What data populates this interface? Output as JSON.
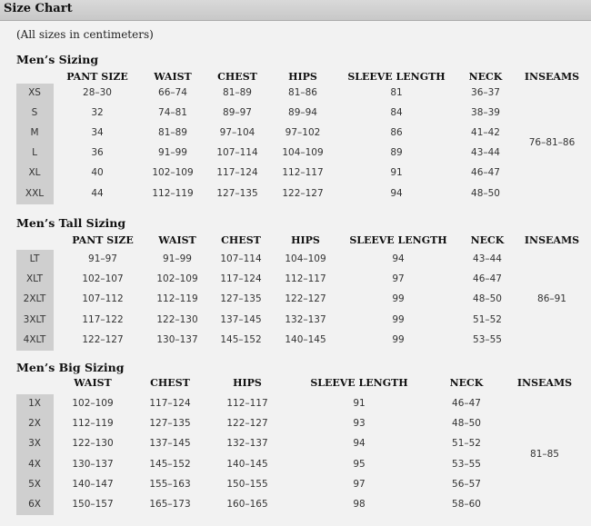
{
  "header": {
    "title": "Size Chart"
  },
  "note": "(All sizes in centimeters)",
  "sections": [
    {
      "title": "Men’s Sizing",
      "headers": [
        "PANT SIZE",
        "WAIST",
        "CHEST",
        "HIPS",
        "SLEEVE LENGTH",
        "NECK",
        "INSEAMS"
      ],
      "rows": [
        {
          "size": "XS",
          "values": [
            "28–30",
            "66–74",
            "81–89",
            "81–86",
            "81",
            "36–37"
          ]
        },
        {
          "size": "S",
          "values": [
            "32",
            "74–81",
            "89–97",
            "89–94",
            "84",
            "38–39"
          ]
        },
        {
          "size": "M",
          "values": [
            "34",
            "81–89",
            "97–104",
            "97–102",
            "86",
            "41–42"
          ]
        },
        {
          "size": "L",
          "values": [
            "36",
            "91–99",
            "107–114",
            "104–109",
            "89",
            "43–44"
          ]
        },
        {
          "size": "XL",
          "values": [
            "40",
            "102–109",
            "117–124",
            "112–117",
            "91",
            "46–47"
          ]
        },
        {
          "size": "XXL",
          "values": [
            "44",
            "112–119",
            "127–135",
            "122–127",
            "94",
            "48–50"
          ]
        }
      ],
      "inseam": "76–81–86"
    },
    {
      "title": "Men’s Tall Sizing",
      "headers": [
        "PANT SIZE",
        "WAIST",
        "CHEST",
        "HIPS",
        "SLEEVE LENGTH",
        "NECK",
        "INSEAMS"
      ],
      "rows": [
        {
          "size": "LT",
          "values": [
            "91–97",
            "91–99",
            "107–114",
            "104–109",
            "94",
            "43–44"
          ]
        },
        {
          "size": "XLT",
          "values": [
            "102–107",
            "102–109",
            "117–124",
            "112–117",
            "97",
            "46–47"
          ]
        },
        {
          "size": "2XLT",
          "values": [
            "107–112",
            "112–119",
            "127–135",
            "122–127",
            "99",
            "48–50"
          ]
        },
        {
          "size": "3XLT",
          "values": [
            "117–122",
            "122–130",
            "137–145",
            "132–137",
            "99",
            "51–52"
          ]
        },
        {
          "size": "4XLT",
          "values": [
            "122–127",
            "130–137",
            "145–152",
            "140–145",
            "99",
            "53–55"
          ]
        }
      ],
      "inseam": "86–91"
    },
    {
      "title": "Men’s Big Sizing",
      "headers": [
        "WAIST",
        "CHEST",
        "HIPS",
        "SLEEVE LENGTH",
        "NECK",
        "INSEAMS"
      ],
      "rows": [
        {
          "size": "1X",
          "values": [
            "102–109",
            "117–124",
            "112–117",
            "91",
            "46–47"
          ]
        },
        {
          "size": "2X",
          "values": [
            "112–119",
            "127–135",
            "122–127",
            "93",
            "48–50"
          ]
        },
        {
          "size": "3X",
          "values": [
            "122–130",
            "137–145",
            "132–137",
            "94",
            "51–52"
          ]
        },
        {
          "size": "4X",
          "values": [
            "130–137",
            "145–152",
            "140–145",
            "95",
            "53–55"
          ]
        },
        {
          "size": "5X",
          "values": [
            "140–147",
            "155–163",
            "150–155",
            "97",
            "56–57"
          ]
        },
        {
          "size": "6X",
          "values": [
            "150–157",
            "165–173",
            "160–165",
            "98",
            "58–60"
          ]
        }
      ],
      "inseam": "81–85"
    }
  ]
}
